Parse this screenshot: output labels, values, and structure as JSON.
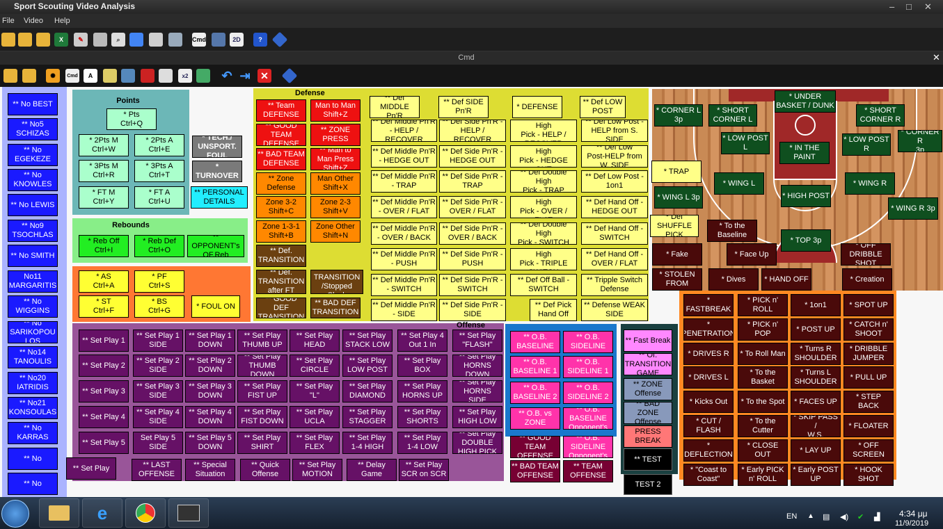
{
  "app": {
    "title": "Sport Scouting Video Analysis",
    "menu": [
      "File",
      "Video",
      "Help"
    ],
    "cmd_title": "Cmd"
  },
  "players": [
    "** No  BEST",
    "** No5\nSCHIZAS",
    "** No\nEGEKEZE",
    "** No\nKNOWLES",
    "** No  LEWIS",
    "** No9\nTSOCHLAS",
    "** No  SMITH",
    "No11\nMARGARITIS",
    "** No\nWIGGINS",
    "** No\nSARIKOPOU\nLOS",
    "** No14\nTANOULIS",
    "** No20\nIATRIDIS",
    "** No21\nKONSOULAS",
    "** No\nKARRAS",
    "** No",
    "** No"
  ],
  "points": {
    "title": "Points",
    "buttons": [
      "* Pts\nCtrl+Q",
      "* 2Pts M\nCtrl+W",
      "* 2Pts A\nCtrl+E",
      "* 3Pts M\nCtrl+R",
      "* 3Pts A\nCtrl+T",
      "* FT M\nCtrl+Y",
      "* FT A\nCtrl+U"
    ],
    "tech": "* TECH./\nUNSPORT.\nFOUL",
    "turnover": "* TURNOVER",
    "personal": "** PERSONAL\nDETAILS"
  },
  "rebounds": {
    "title": "Rebounds",
    "buttons": [
      "* Reb Off\nCtrl+I",
      "* Reb Def\nCtrl+O",
      "** OPPONENT's\nOF.Reb"
    ]
  },
  "stats": {
    "buttons": [
      "* AS\nCtrl+A",
      "* PF\nCtrl+S",
      "* ST\nCtrl+F",
      "* BS\nCtrl+G"
    ],
    "foul_on": "* FOUL ON"
  },
  "defense": {
    "title": "Defense",
    "red": [
      "** Team\nDEFENSE",
      "Man to Man\nShift+Z",
      "** GOOD\nTEAM\nDEFENSE",
      "** ZONE\nPRESS",
      "** BAD TEAM\nDEFENSE",
      "** Man to\nMan Press\nShift+Z"
    ],
    "orange": [
      "** Zone\nDefense",
      "Man Other\nShift+X",
      "Zone 3-2\nShift+C",
      "Zone 2-3\nShift+V",
      "Zone 1-3-1\nShift+B",
      "Zone Other\nShift+N"
    ],
    "brown": [
      "** Def.\nTRANSITION",
      "** Def.\nTRANSITION\nafter FT",
      "** Def.\nTRANSITION\n/Stopped Clock",
      "** GOOD DEF\nTRANSITION",
      "** BAD DEF\nTRANSITION"
    ],
    "col1": [
      "** Def\nMIDDLE Pn'R",
      "** Def Middle Pn'R\n- HELP /\nRECOVER",
      "** Def Middle Pn'R\n- HEDGE OUT",
      "** Def Middle Pn'R\n- TRAP",
      "** Def Middle Pn'R\n- OVER / FLAT",
      "** Def Middle Pn'R\n- OVER / BACK",
      "** Def Middle Pn'R\n- PUSH",
      "** Def Middle Pn'R\n- SWITCH",
      "** Def Middle Pn'R\n- SIDE"
    ],
    "col2": [
      "** Def SIDE\nPn'R",
      "** Def Side Pn'R -\nHELP / RECOVER",
      "** Def Side Pn'R -\nHEDGE OUT",
      "** Def Side Pn'R -\nTRAP",
      "** Def Side Pn'R -\nOVER / FLAT",
      "** Def Side Pn'R -\nOVER / BACK",
      "** Def Side Pn'R -\nPUSH",
      "** Def Side Pn'R -\nSWITCH",
      "** Def Side Pn'R -\nSIDE"
    ],
    "col3": [
      "* DEFENSE",
      "** Def Double High\nPick - HELP /\nRECOVER",
      "** Def Double High\nPick - HEDGE OUT",
      "** Def Double High\nPick - TRAP",
      "** Def Double High\nPick - OVER /\nFLAT",
      "** Def Double High\nPick - SWITCH",
      "** Def Double High\nPick - TRIPLE\nSWITCH",
      "** Def Off Ball -\nSWITCH",
      "** Def Pick\nHand Off"
    ],
    "col4": [
      "** Def LOW\nPOST",
      "** Def Low Post -\nHELP from S. SIDE",
      "** Def Low\nPost-HELP from\nW. SIDE",
      "** Def Low Post -\n1on1",
      "** Def Hand Off -\nHEDGE OUT",
      "** Def Hand Off -\nSWITCH",
      "** Def Hand Off -\nOVER / FLAT",
      "** Tripple Switch\nDefense",
      "** Defense WEAK\nSIDE"
    ],
    "extra": [
      "* TRAP",
      "* Def\nSHUFFLE\nPICK"
    ]
  },
  "court": {
    "green": [
      "* UNDER\nBASKET / DUNK",
      "* CORNER L\n3p",
      "* SHORT\nCORNER L",
      "* SHORT\nCORNER R",
      "* CORNER R\n3p",
      "* LOW POST\nL",
      "* IN THE\nPAINT",
      "* LOW POST\nR",
      "* WING L",
      "* WING R",
      "* HIGH POST",
      "* WING L 3p",
      "* WING R 3p",
      "* TOP 3p"
    ],
    "maroon": [
      "* To the\nBaseline",
      "* OFF\nDRIBBLE\nSHOT",
      "* Fake",
      "* Face Up",
      "* STOLEN\nFROM",
      "* Dives",
      "* HAND OFF",
      "* Creation"
    ]
  },
  "offense": {
    "title": "Offense",
    "setplays": [
      "** Set Play 1",
      "** Set Play 1\nSIDE",
      "** Set Play 1\nDOWN",
      "** Set Play\nTHUMB UP",
      "** Set Play\nHEAD",
      "** Set Play\nSTACK LOW",
      "** Set Play 4\nOut 1 In",
      "** Set Play\n\"FLASH\"",
      "** Set Play 2",
      "** Set Play 2\nSIDE",
      "** Set Play 2\nDOWN",
      "** Set Play\nTHUMB\nDOWN",
      "** Set Play\nCIRCLE",
      "** Set Play\nLOW POST",
      "** Set Play\nBOX",
      "** Set Play\nHORNS\nDOWN",
      "** Set Play 3",
      "** Set Play 3\nSIDE",
      "** Set Play 3\nDOWN",
      "** Set Play\nFIST UP",
      "** Set Play\n\"L\"",
      "** Set Play\nDIAMOND",
      "** Set Play\nHORNS UP",
      "** Set Play\nHORNS SIDE",
      "** Set Play 4",
      "** Set Play 4\nSIDE",
      "** Set Play 4\nDOWN",
      "** Set Play\nFIST DOWN",
      "** Set Play\nUCLA",
      "** Set Play\nSTAGGER",
      "** Set Play\nSHORTS",
      "** Set Play\nHIGH LOW",
      "** Set Play 5",
      "Set Play 5\nSIDE",
      "** Set Play 5\nDOWN",
      "** Set Play\nSHIRT",
      "** Set Play\nFLEX",
      "** Set Play\n1-4 HIGH",
      "** Set Play\n1-4 LOW",
      "** Set Play\nDOUBLE\nHIGH PICK"
    ],
    "bottom": [
      "** Set Play",
      "** LAST\nOFFENSE",
      "** Special\nSituation",
      "** Quick\nOffense",
      "** Set Play\nMOTION",
      "** Delay\nGame",
      "** Set Play\nSCR on SCR"
    ]
  },
  "ob": [
    "** O.B.\nBASELINE",
    "** O.B.\nSIDELINE",
    "** O.B.\nBASELINE 1",
    "** O.B.\nSIDELINE 1",
    "** O.B.\nBASELINE 2",
    "** O.B.\nSIDELINE 2",
    "** O.B. vs\nZONE",
    "** O.B.\nBASELINE\nOpponent's",
    "** GOOD\nTEAM\nOFFENSE",
    "** O.B.\nSIDELINE\nOpponent's",
    "** BAD TEAM\nOFFENSE",
    "** TEAM\nOFFENSE"
  ],
  "transition": [
    "** Fast Break",
    "** Of.\nTRANSITION\nGAME",
    "** ZONE\nOffense",
    "** BAD ZONE\nOffense",
    "PRESS\nBREAK",
    "** TEST",
    "TEST 2"
  ],
  "actions": [
    "*\nFASTBREAK",
    "* PICK n'\nROLL",
    "* 1on1",
    "* SPOT UP",
    "*\nPENETRATION",
    "* PICK n' POP",
    "* POST UP",
    "* CATCH n'\nSHOOT",
    "* DRIVES R",
    "* To Roll Man",
    "* Turns R\nSHOULDER",
    "* DRIBBLE\nJUMPER",
    "* DRIVES L",
    "* To the\nBasket",
    "* Turns L\nSHOULDER",
    "* PULL UP",
    "* Kicks Out",
    "* To the Spot",
    "* FACES UP",
    "* STEP BACK",
    "* CUT /\nFLASH",
    "* To the\nCutter",
    "* SKIP PASS /\nW.S.",
    "* FLOATER",
    "*\nDEFLECTION",
    "* CLOSE OUT",
    "* LAY UP",
    "* OFF\nSCREEN",
    "* \"Coast to\nCoast\"",
    "* Early PICK\nn' ROLL",
    "* Early POST\nUP",
    "* HOOK\nSHOT"
  ],
  "taskbar": {
    "lang": "EN",
    "time": "4:34 μμ",
    "date": "11/9/2019"
  },
  "colors": {
    "blue": "#1a1aff",
    "yellow": "#ffff33",
    "red": "#ee1111",
    "orange": "#ff8800",
    "purple": "#661166",
    "pink": "#ff33aa",
    "green": "#0f4f1f"
  }
}
